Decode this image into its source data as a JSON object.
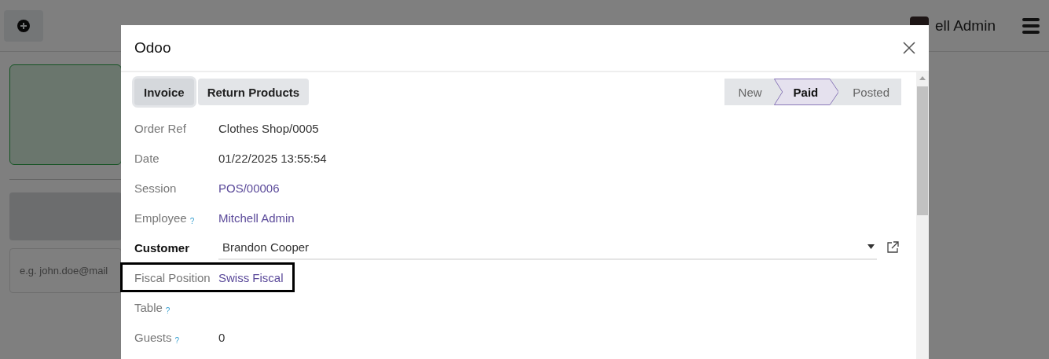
{
  "topbar": {
    "user_name": "ell Admin"
  },
  "background": {
    "email_placeholder": "e.g. john.doe@mail"
  },
  "modal": {
    "title": "Odoo",
    "buttons": [
      {
        "label": "Invoice",
        "selected": true
      },
      {
        "label": "Return Products",
        "selected": false
      }
    ],
    "status_steps": [
      {
        "label": "New",
        "selected": false
      },
      {
        "label": "Paid",
        "selected": true
      },
      {
        "label": "Posted",
        "selected": false
      }
    ],
    "fields": [
      {
        "label": "Order Ref",
        "value": "Clothes Shop/0005",
        "kind": "text",
        "required": false,
        "highlighted": false
      },
      {
        "label": "Date",
        "value": "01/22/2025 13:55:54",
        "kind": "text",
        "required": false,
        "highlighted": false
      },
      {
        "label": "Session",
        "value": "POS/00006",
        "kind": "link",
        "required": false,
        "highlighted": false
      },
      {
        "label": "Employee",
        "help": "?",
        "value": "Mitchell Admin",
        "kind": "link",
        "required": false,
        "highlighted": false
      },
      {
        "label": "Customer",
        "value": "Brandon Cooper",
        "kind": "select",
        "required": true,
        "highlighted": false
      },
      {
        "label": "Fiscal Position",
        "value": "Swiss Fiscal",
        "kind": "link",
        "required": false,
        "highlighted": true
      },
      {
        "label": "Table",
        "help": "?",
        "kind": "text",
        "required": false,
        "highlighted": false
      },
      {
        "label": "Guests",
        "help": "?",
        "value": "0",
        "kind": "text",
        "required": false,
        "highlighted": false
      }
    ]
  }
}
